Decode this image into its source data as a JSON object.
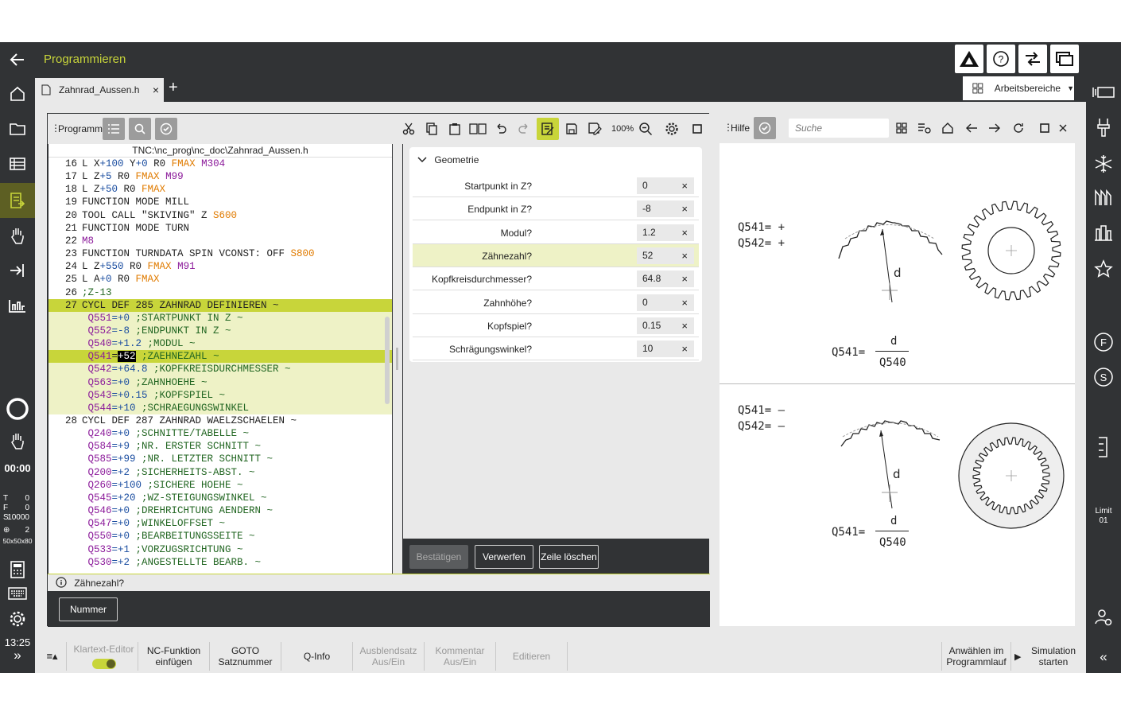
{
  "app": {
    "title": "Programmieren",
    "back_icon": "arrow-left-icon"
  },
  "tabs": {
    "file": "Zahnrad_Aussen.h",
    "close": "×",
    "plus": "+",
    "arbeitsbereiche": "Arbeitsbereiche",
    "arbeits_arrow": "▼"
  },
  "left": {
    "timer": "00:00",
    "t_label": "T",
    "t_val": "0",
    "f_label": "F",
    "f_val": "0",
    "s_label": "S",
    "s_val": "10000",
    "spindle_val": "2",
    "raw": "50x50x80",
    "clock": "13:25",
    "expand": "»"
  },
  "right": {
    "limit": "Limit",
    "limit_val": "01",
    "collapse": "«"
  },
  "program": {
    "label": "Programm",
    "zoom": "100%",
    "path": "TNC:\\nc_prog\\nc_doc\\Zahnrad_Aussen.h"
  },
  "code": [
    {
      "n": "16",
      "t": [
        [
          "kw",
          "L "
        ],
        [
          "kw",
          "X"
        ],
        [
          "sub",
          "+100"
        ],
        [
          "kw",
          " Y"
        ],
        [
          "sub",
          "+0"
        ],
        [
          "kw",
          " R0 "
        ],
        [
          "f",
          "FMAX"
        ],
        [
          "m",
          " M304"
        ]
      ]
    },
    {
      "n": "17",
      "t": [
        [
          "kw",
          "L Z"
        ],
        [
          "sub",
          "+5"
        ],
        [
          "kw",
          " R0 "
        ],
        [
          "f",
          "FMAX"
        ],
        [
          "m",
          " M99"
        ]
      ]
    },
    {
      "n": "18",
      "t": [
        [
          "kw",
          "L Z"
        ],
        [
          "sub",
          "+50"
        ],
        [
          "kw",
          " R0 "
        ],
        [
          "f",
          "FMAX"
        ]
      ]
    },
    {
      "n": "19",
      "t": [
        [
          "kw",
          "FUNCTION MODE MILL"
        ]
      ]
    },
    {
      "n": "20",
      "t": [
        [
          "kw",
          "TOOL CALL "
        ],
        [
          "kw",
          "\"SKIVING\""
        ],
        [
          "kw",
          " Z "
        ],
        [
          "f",
          "S600"
        ]
      ]
    },
    {
      "n": "21",
      "t": [
        [
          "kw",
          "FUNCTION MODE TURN"
        ]
      ]
    },
    {
      "n": "22",
      "t": [
        [
          "m",
          "M8"
        ]
      ]
    },
    {
      "n": "23",
      "t": [
        [
          "kw",
          "FUNCTION TURNDATA SPIN VCONST: OFF "
        ],
        [
          "f",
          "S800"
        ]
      ]
    },
    {
      "n": "24",
      "t": [
        [
          "kw",
          "L Z"
        ],
        [
          "sub",
          "+550"
        ],
        [
          "kw",
          " R0 "
        ],
        [
          "f",
          "FMAX"
        ],
        [
          "m",
          " M91"
        ]
      ]
    },
    {
      "n": "25",
      "t": [
        [
          "kw",
          "L A"
        ],
        [
          "sub",
          "+0"
        ],
        [
          "kw",
          " R0 "
        ],
        [
          "f",
          "FMAX"
        ]
      ]
    },
    {
      "n": "26",
      "t": [
        [
          "c",
          ";Z-13"
        ]
      ]
    },
    {
      "n": "27",
      "t": [
        [
          "kw",
          "CYCL DEF 285 ZAHNRAD DEFINIEREN ~"
        ]
      ],
      "cls": "sel"
    },
    {
      "n": "",
      "t": [
        [
          "q",
          " Q551"
        ],
        [
          "sub",
          "=+0"
        ],
        [
          "c",
          " ;STARTPUNKT IN Z ~"
        ]
      ],
      "cls": "par"
    },
    {
      "n": "",
      "t": [
        [
          "q",
          " Q552"
        ],
        [
          "sub",
          "=-8"
        ],
        [
          "c",
          " ;ENDPUNKT IN Z ~"
        ]
      ],
      "cls": "par"
    },
    {
      "n": "",
      "t": [
        [
          "q",
          " Q540"
        ],
        [
          "sub",
          "=+1.2"
        ],
        [
          "c",
          " ;MODUL ~"
        ]
      ],
      "cls": "par"
    },
    {
      "n": "",
      "t": [
        [
          "q",
          " Q541"
        ],
        [
          "kw",
          "="
        ],
        [
          "hi",
          "+52"
        ],
        [
          "c",
          " ;ZAEHNEZAHL ~"
        ]
      ],
      "cls": "sel"
    },
    {
      "n": "",
      "t": [
        [
          "q",
          " Q542"
        ],
        [
          "sub",
          "=+64.8"
        ],
        [
          "c",
          " ;KOPFKREISDURCHMESSER ~"
        ]
      ],
      "cls": "par"
    },
    {
      "n": "",
      "t": [
        [
          "q",
          " Q563"
        ],
        [
          "sub",
          "=+0"
        ],
        [
          "c",
          " ;ZAHNHOEHE ~"
        ]
      ],
      "cls": "par"
    },
    {
      "n": "",
      "t": [
        [
          "q",
          " Q543"
        ],
        [
          "sub",
          "=+0.15"
        ],
        [
          "c",
          " ;KOPFSPIEL ~"
        ]
      ],
      "cls": "par"
    },
    {
      "n": "",
      "t": [
        [
          "q",
          " Q544"
        ],
        [
          "sub",
          "=+10"
        ],
        [
          "c",
          " ;SCHRAEGUNGSWINKEL"
        ]
      ],
      "cls": "par"
    },
    {
      "n": "28",
      "t": [
        [
          "kw",
          "CYCL DEF 287 ZAHNRAD WAELZSCHAELEN ~"
        ]
      ]
    },
    {
      "n": "",
      "t": [
        [
          "q",
          " Q240"
        ],
        [
          "sub",
          "=+0"
        ],
        [
          "c",
          " ;SCHNITTE/TABELLE ~"
        ]
      ]
    },
    {
      "n": "",
      "t": [
        [
          "q",
          " Q584"
        ],
        [
          "sub",
          "=+9"
        ],
        [
          "c",
          " ;NR. ERSTER SCHNITT ~"
        ]
      ]
    },
    {
      "n": "",
      "t": [
        [
          "q",
          " Q585"
        ],
        [
          "sub",
          "=+99"
        ],
        [
          "c",
          " ;NR. LETZTER SCHNITT ~"
        ]
      ]
    },
    {
      "n": "",
      "t": [
        [
          "q",
          " Q200"
        ],
        [
          "sub",
          "=+2"
        ],
        [
          "c",
          " ;SICHERHEITS-ABST. ~"
        ]
      ]
    },
    {
      "n": "",
      "t": [
        [
          "q",
          " Q260"
        ],
        [
          "sub",
          "=+100"
        ],
        [
          "c",
          " ;SICHERE HOEHE ~"
        ]
      ]
    },
    {
      "n": "",
      "t": [
        [
          "q",
          " Q545"
        ],
        [
          "sub",
          "=+20"
        ],
        [
          "c",
          " ;WZ-STEIGUNGSWINKEL ~"
        ]
      ]
    },
    {
      "n": "",
      "t": [
        [
          "q",
          " Q546"
        ],
        [
          "sub",
          "=+0"
        ],
        [
          "c",
          " ;DREHRICHTUNG AENDERN ~"
        ]
      ]
    },
    {
      "n": "",
      "t": [
        [
          "q",
          " Q547"
        ],
        [
          "sub",
          "=+0"
        ],
        [
          "c",
          " ;WINKELOFFSET ~"
        ]
      ]
    },
    {
      "n": "",
      "t": [
        [
          "q",
          " Q550"
        ],
        [
          "sub",
          "=+0"
        ],
        [
          "c",
          " ;BEARBEITUNGSSEITE ~"
        ]
      ]
    },
    {
      "n": "",
      "t": [
        [
          "q",
          " Q533"
        ],
        [
          "sub",
          "=+1"
        ],
        [
          "c",
          " ;VORZUGSRICHTUNG ~"
        ]
      ]
    },
    {
      "n": "",
      "t": [
        [
          "q",
          " Q530"
        ],
        [
          "sub",
          "=+2"
        ],
        [
          "c",
          " ;ANGESTELLTE BEARB. ~"
        ]
      ]
    }
  ],
  "form": {
    "section": "Geometrie",
    "rows": [
      {
        "label": "Startpunkt in Z?",
        "value": "0"
      },
      {
        "label": "Endpunkt in Z?",
        "value": "-8"
      },
      {
        "label": "Modul?",
        "value": "1.2"
      },
      {
        "label": "Zähnezahl?",
        "value": "52"
      },
      {
        "label": "Kopfkreisdurchmesser?",
        "value": "64.8"
      },
      {
        "label": "Zahnhöhe?",
        "value": "0"
      },
      {
        "label": "Kopfspiel?",
        "value": "0.15"
      },
      {
        "label": "Schrägungswinkel?",
        "value": "10"
      }
    ],
    "clear": "×",
    "confirm": "Bestätigen",
    "discard": "Verwerfen",
    "delete_line": "Zeile löschen"
  },
  "info": "Zähnezahl?",
  "number_btn": "Nummer",
  "help": {
    "label": "Hilfe",
    "search_placeholder": "Suche",
    "top": {
      "l1": "Q541= +",
      "l2": "Q542= +",
      "d": "d",
      "frac_lhs": "Q541=",
      "frac_num": "d",
      "frac_den": "Q540"
    },
    "bottom": {
      "l1": "Q541= –",
      "l2": "Q542= –",
      "d": "d",
      "frac_lhs": "Q541=",
      "frac_num": "d",
      "frac_den": "Q540"
    }
  },
  "softkeys": {
    "menu": "≡▴",
    "klartext": "Klartext-Editor",
    "nc_fn_1": "NC-Funktion",
    "nc_fn_2": "einfügen",
    "goto_1": "GOTO",
    "goto_2": "Satznummer",
    "qinfo": "Q-Info",
    "ausbl_1": "Ausblendsatz",
    "ausbl_2": "Aus/Ein",
    "komm_1": "Kommentar",
    "komm_2": "Aus/Ein",
    "edit": "Editieren",
    "anw_1": "Anwählen im",
    "anw_2": "Programmlauf",
    "sim_1": "Simulation",
    "sim_2": "starten"
  },
  "colors": {
    "accent": "#c8d53a",
    "dark": "#313335",
    "selection": "#c8d53a",
    "param_bg": "#eef2c6"
  }
}
